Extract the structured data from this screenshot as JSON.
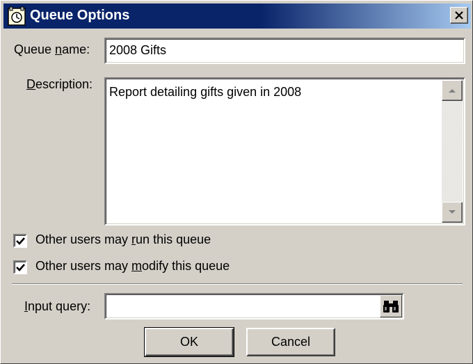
{
  "window": {
    "title": "Queue Options",
    "title_bar_color": "#0a246a",
    "face_color": "#d4d0c8"
  },
  "queue_name": {
    "label_pre": "Queue ",
    "label_key": "n",
    "label_post": "ame:",
    "value": "2008 Gifts"
  },
  "description": {
    "label_key": "D",
    "label_post": "escription:",
    "value": "Report detailing gifts given in 2008"
  },
  "options": [
    {
      "label_pre": "Other users may ",
      "label_key": "r",
      "label_post": "un this queue",
      "checked": true
    },
    {
      "label_pre": "Other users may ",
      "label_key": "m",
      "label_post": "odify this queue",
      "checked": true
    }
  ],
  "input_query": {
    "label_key": "I",
    "label_post": "nput query:",
    "value": "",
    "button_icon": "binoculars-icon"
  },
  "buttons": {
    "ok_label": "OK",
    "cancel_label": "Cancel"
  }
}
